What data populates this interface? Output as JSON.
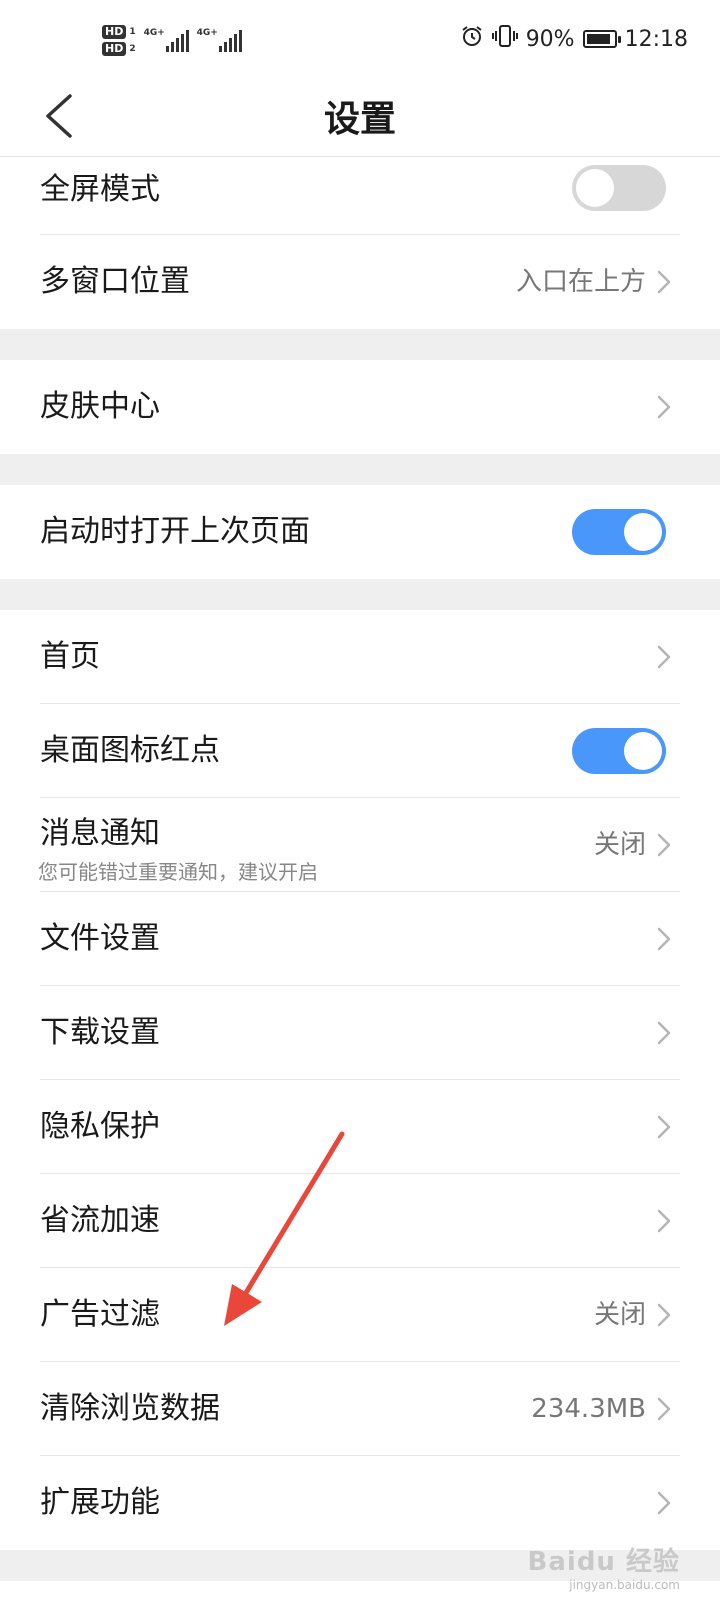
{
  "status_bar": {
    "hd1": "HD",
    "hd1_sub": "1",
    "hd2": "HD",
    "hd2_sub": "2",
    "sig1_label": "4G+",
    "sig2_label": "4G+",
    "battery_text": "90%",
    "battery_level": 0.9,
    "time": "12:18",
    "icons": [
      "alarm-icon",
      "vibrate-icon",
      "battery-icon"
    ]
  },
  "header": {
    "title": "设置",
    "back_icon": "chevron-left-icon"
  },
  "settings": {
    "fullscreen": {
      "label": "全屏模式",
      "toggle": "off"
    },
    "multiwindow": {
      "label": "多窗口位置",
      "value": "入口在上方"
    },
    "skin": {
      "label": "皮肤中心"
    },
    "restore": {
      "label": "启动时打开上次页面",
      "toggle": "on"
    },
    "home": {
      "label": "首页"
    },
    "reddot": {
      "label": "桌面图标红点",
      "toggle": "on"
    },
    "notify": {
      "label": "消息通知",
      "sub": "您可能错过重要通知，建议开启",
      "value": "关闭"
    },
    "file": {
      "label": "文件设置"
    },
    "download": {
      "label": "下载设置"
    },
    "privacy": {
      "label": "隐私保护"
    },
    "datasave": {
      "label": "省流加速"
    },
    "adblock": {
      "label": "广告过滤",
      "value": "关闭"
    },
    "clear": {
      "label": "清除浏览数据",
      "value": "234.3MB"
    },
    "extensions": {
      "label": "扩展功能"
    }
  },
  "annotation": {
    "color": "#e8473a"
  },
  "watermark": {
    "main": "Baidu 经验",
    "sub": "jingyan.baidu.com"
  },
  "colors": {
    "toggle_on": "#4a97fb",
    "toggle_off": "#d7d7d7",
    "section_gap": "#efefef"
  }
}
